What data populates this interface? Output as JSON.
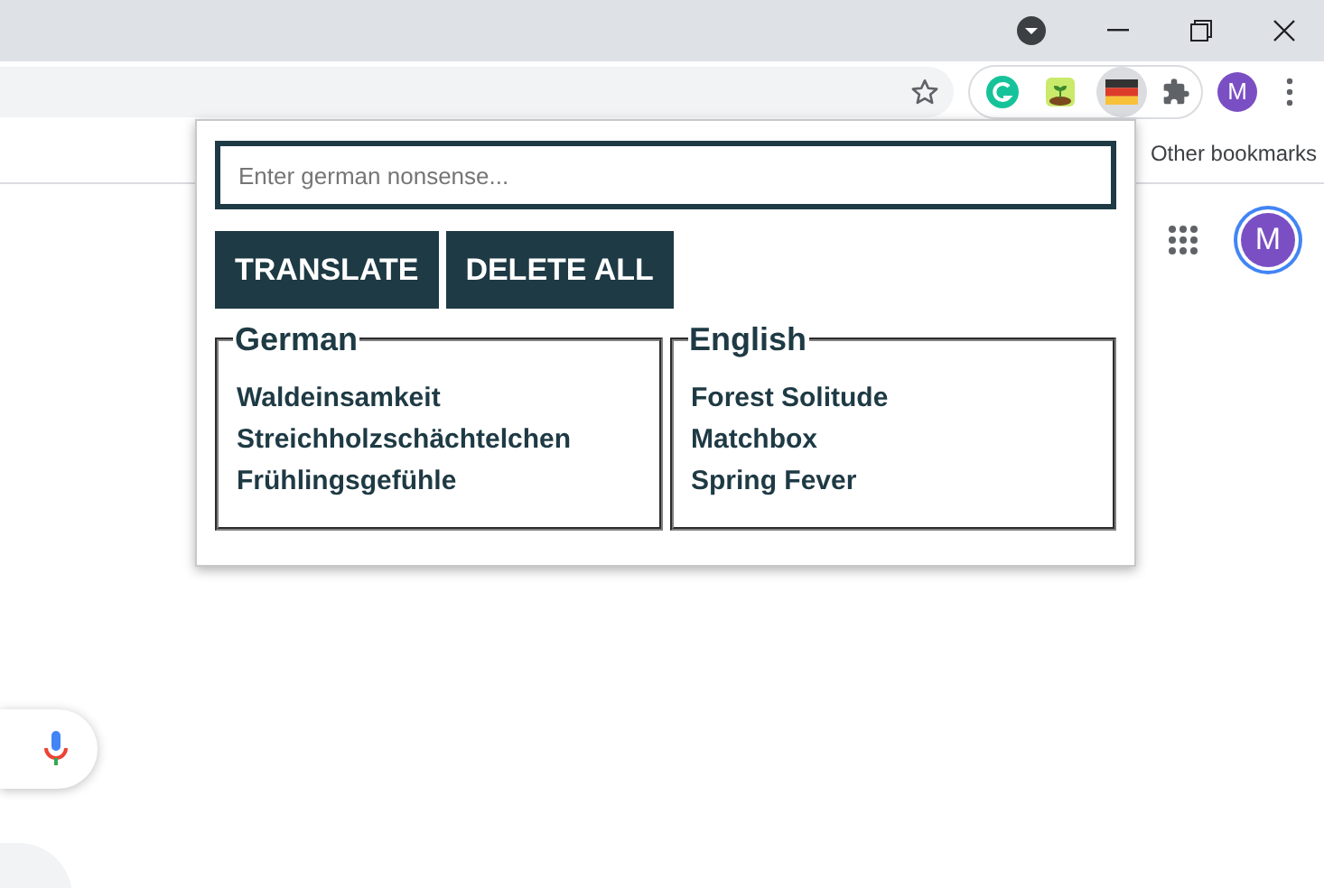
{
  "toolbar": {
    "profile_initial": "M"
  },
  "bookmarks_bar": {
    "other_bookmarks": "Other bookmarks"
  },
  "page": {
    "profile_initial": "M"
  },
  "popup": {
    "input": {
      "placeholder": "Enter german nonsense..."
    },
    "buttons": [
      "TRANSLATE",
      "DELETE ALL"
    ],
    "panels": [
      {
        "legend": "German",
        "words": [
          "Waldeinsamkeit",
          "Streichholzschächtelchen",
          "Frühlingsgefühle"
        ]
      },
      {
        "legend": "English",
        "words": [
          "Forest Solitude",
          "Matchbox",
          "Spring Fever"
        ]
      }
    ]
  }
}
